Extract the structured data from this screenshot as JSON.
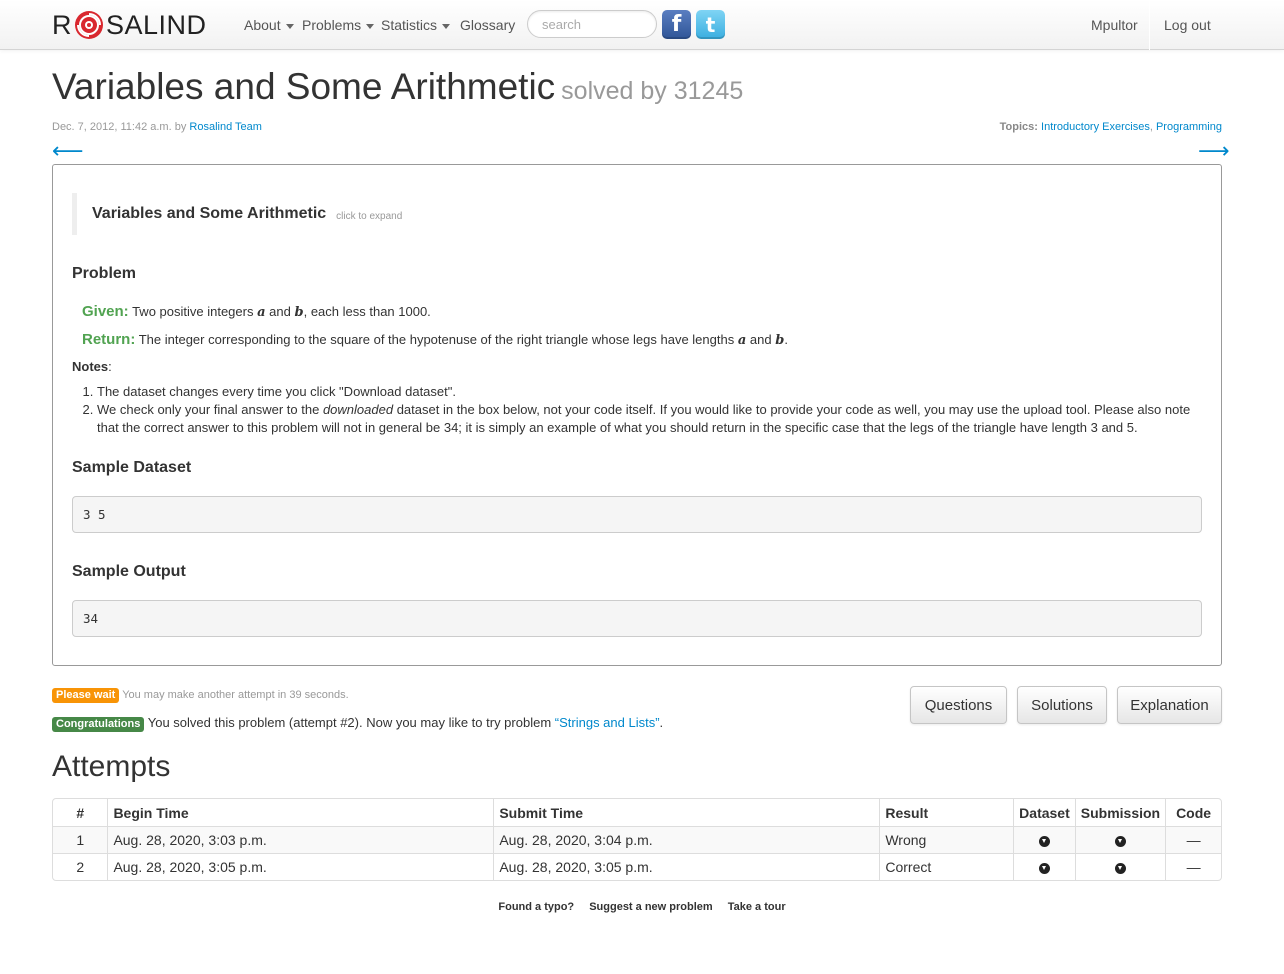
{
  "nav": {
    "brand_left": "R",
    "brand_right": "SALIND",
    "about": "About",
    "problems": "Problems",
    "statistics": "Statistics",
    "glossary": "Glossary",
    "search_placeholder": "search",
    "facebook_glyph": "f",
    "twitter_glyph": "t",
    "user": "Mpultor",
    "logout": "Log out"
  },
  "header": {
    "title": "Variables and Some Arithmetic",
    "solved_by": "solved by 31245",
    "date": "Dec. 7, 2012, 11:42 a.m. by",
    "author": "Rosalind Team",
    "topics_label": "Topics:",
    "topic_1": "Introductory Exercises",
    "topic_sep": ",",
    "topic_2": "Programming",
    "prev_arrow": "⟵",
    "next_arrow": "⟶"
  },
  "problem": {
    "quote_title": "Variables and Some Arithmetic",
    "quote_hint": "click to expand",
    "heading": "Problem",
    "given_label": "Given:",
    "given_1": "Two positive integers",
    "var_a": "a",
    "and": "and",
    "var_b": "b",
    "given_2": ", each less than 1000.",
    "return_label": "Return:",
    "return_1": "The integer corresponding to the square of the hypotenuse of the right triangle whose legs have lengths",
    "period": ".",
    "notes_label": "Notes",
    "notes_colon": ":",
    "note_1": "The dataset changes every time you click \"Download dataset\".",
    "note_2a": "We check only your final answer to the",
    "note_2_em": "downloaded",
    "note_2b": "dataset in the box below, not your code itself. If you would like to provide your code as well, you may use the upload tool. Please also note that the correct answer to this problem will not in general be 34; it is simply an example of what you should return in the specific case that the legs of the triangle have length 3 and 5.",
    "sample_dataset_heading": "Sample Dataset",
    "sample_dataset": "3 5",
    "sample_output_heading": "Sample Output",
    "sample_output": "34"
  },
  "status": {
    "wait_badge": "Please wait",
    "wait_text": "You may make another attempt in 39 seconds.",
    "ok_badge": "Congratulations",
    "ok_text": "You solved this problem (attempt #2). Now you may like to try problem",
    "next_problem": "“Strings and Lists”",
    "ok_end": "."
  },
  "buttons": {
    "questions": "Questions",
    "solutions": "Solutions",
    "explanation": "Explanation"
  },
  "attempts": {
    "title": "Attempts",
    "headers": [
      "#",
      "Begin Time",
      "Submit Time",
      "Result",
      "Dataset",
      "Submission",
      "Code"
    ],
    "rows": [
      {
        "n": "1",
        "begin": "Aug. 28, 2020, 3:03 p.m.",
        "submit": "Aug. 28, 2020, 3:04 p.m.",
        "result": "Wrong",
        "code": "—"
      },
      {
        "n": "2",
        "begin": "Aug. 28, 2020, 3:05 p.m.",
        "submit": "Aug. 28, 2020, 3:05 p.m.",
        "result": "Correct",
        "code": "—"
      }
    ]
  },
  "footer": {
    "typo": "Found a typo?",
    "suggest": "Suggest a new problem",
    "tour": "Take a tour"
  },
  "colors": {
    "link": "#0088cc",
    "given_green": "#51a351",
    "badge_wait": "#f89406",
    "badge_ok": "#468847"
  }
}
